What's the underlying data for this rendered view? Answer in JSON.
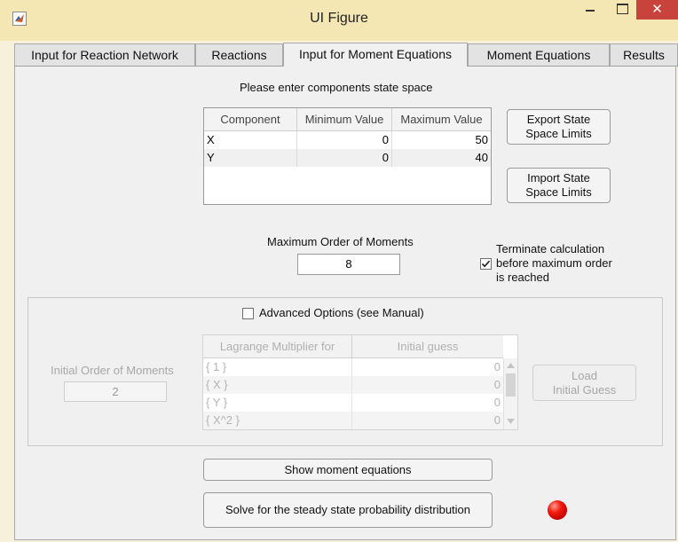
{
  "window": {
    "title": "UI Figure",
    "close_glyph": "✕",
    "app_icon": "matlab-figure-icon"
  },
  "tabs": [
    {
      "label": "Input for Reaction Network",
      "active": false
    },
    {
      "label": "Reactions",
      "active": false
    },
    {
      "label": "Input for Moment Equations",
      "active": true
    },
    {
      "label": "Moment Equations",
      "active": false
    },
    {
      "label": "Results",
      "active": false
    }
  ],
  "state_space": {
    "prompt": "Please enter components state space",
    "columns": [
      "Component",
      "Minimum Value",
      "Maximum Value"
    ],
    "rows": [
      {
        "component": "X",
        "min": "0",
        "max": "50"
      },
      {
        "component": "Y",
        "min": "0",
        "max": "40"
      }
    ],
    "export_label_1": "Export State",
    "export_label_2": "Space Limits",
    "import_label_1": "Import State",
    "import_label_2": "Space Limits"
  },
  "moments": {
    "max_order_label": "Maximum Order of  Moments",
    "max_order_value": "8",
    "terminate_line1": "Terminate calculation",
    "terminate_line2": "before maximum order",
    "terminate_line3": "is reached",
    "terminate_checked": true
  },
  "advanced": {
    "label": "Advanced  Options (see Manual)",
    "checked": false,
    "initial_order_label": "Initial Order of Moments",
    "initial_order_value": "2",
    "columns": [
      "Lagrange Multiplier for",
      "Initial guess"
    ],
    "rows": [
      {
        "name": "{ 1 }",
        "guess": "0"
      },
      {
        "name": "{ X }",
        "guess": "0"
      },
      {
        "name": "{ Y }",
        "guess": "0"
      },
      {
        "name": "{ X^2 }",
        "guess": "0"
      }
    ],
    "load_label_1": "Load",
    "load_label_2": "Initial Guess"
  },
  "actions": {
    "show_label": "Show moment equations",
    "solve_label": "Solve for the steady state probability distribution",
    "status_color": "#e01010"
  }
}
